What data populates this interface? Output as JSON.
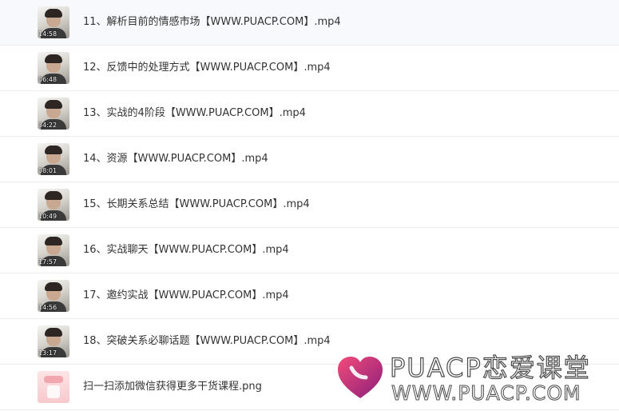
{
  "files": [
    {
      "name": "11、解析目前的情感市场【WWW.PUACP.COM】.mp4",
      "duration": "14:58",
      "type": "video"
    },
    {
      "name": "12、反馈中的处理方式【WWW.PUACP.COM】.mp4",
      "duration": "06:48",
      "type": "video"
    },
    {
      "name": "13、实战的4阶段【WWW.PUACP.COM】.mp4",
      "duration": "34:22",
      "type": "video"
    },
    {
      "name": "14、资源【WWW.PUACP.COM】.mp4",
      "duration": "08:01",
      "type": "video"
    },
    {
      "name": "15、长期关系总结【WWW.PUACP.COM】.mp4",
      "duration": "10:49",
      "type": "video"
    },
    {
      "name": "16、实战聊天【WWW.PUACP.COM】.mp4",
      "duration": "17:57",
      "type": "video"
    },
    {
      "name": "17、邀约实战【WWW.PUACP.COM】.mp4",
      "duration": "14:56",
      "type": "video"
    },
    {
      "name": "18、突破关系必聊话题【WWW.PUACP.COM】.mp4",
      "duration": "13:17",
      "type": "video"
    },
    {
      "name": "扫一扫添加微信获得更多干货课程.png",
      "duration": "",
      "type": "image"
    }
  ],
  "watermark": {
    "title": "PUACP恋爱课堂",
    "url": "WWW.PUACP.COM",
    "colors": {
      "heart_start": "#f24b7a",
      "heart_end": "#8a1f7a"
    }
  }
}
